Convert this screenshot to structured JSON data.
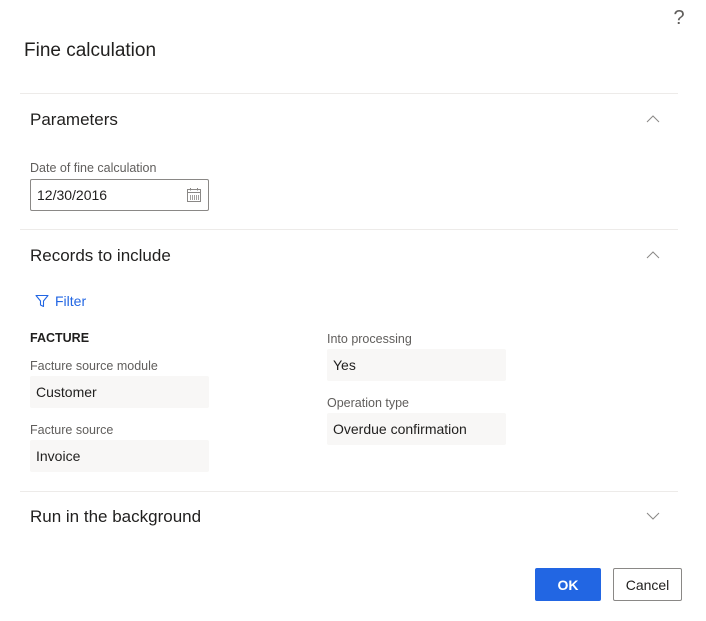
{
  "dialog": {
    "title": "Fine calculation",
    "help_icon": "?"
  },
  "sections": {
    "parameters": {
      "title": "Parameters",
      "expanded": true,
      "date_label": "Date of fine calculation",
      "date_value": "12/30/2016"
    },
    "records": {
      "title": "Records to include",
      "expanded": true,
      "filter_label": "Filter",
      "group_label": "FACTURE",
      "fields": {
        "source_module": {
          "label": "Facture source module",
          "value": "Customer"
        },
        "source": {
          "label": "Facture source",
          "value": "Invoice"
        },
        "into_processing": {
          "label": "Into processing",
          "value": "Yes"
        },
        "operation_type": {
          "label": "Operation type",
          "value": "Overdue confirmation"
        }
      }
    },
    "background": {
      "title": "Run in the background",
      "expanded": false
    }
  },
  "footer": {
    "ok_label": "OK",
    "cancel_label": "Cancel"
  },
  "colors": {
    "accent": "#2266e3",
    "readonly_bg": "#f8f7f6",
    "divider": "#edebe9"
  }
}
